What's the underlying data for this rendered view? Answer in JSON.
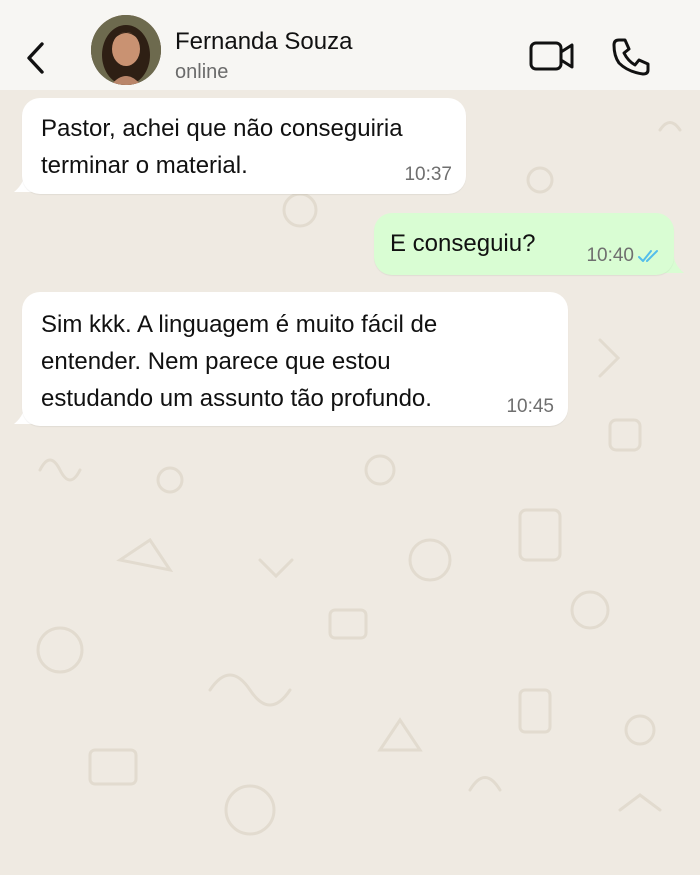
{
  "header": {
    "contact_name": "Fernanda Souza",
    "status": "online",
    "icons": {
      "back": "chevron-left-icon",
      "video": "video-camera-icon",
      "call": "phone-icon"
    }
  },
  "messages": [
    {
      "direction": "incoming",
      "text_lines": [
        "Pastor, achei que não conseguiria",
        "terminar o material."
      ],
      "time": "10:37"
    },
    {
      "direction": "outgoing",
      "text_lines": [
        "E conseguiu?"
      ],
      "time": "10:40",
      "status": "read"
    },
    {
      "direction": "incoming",
      "text_lines": [
        "Sim kkk. A linguagem é muito fácil de",
        "entender. Nem parece que estou",
        "estudando um assunto tão profundo."
      ],
      "time": "10:45"
    }
  ],
  "colors": {
    "header_bg": "#f7f6f3",
    "chat_bg": "#efeae2",
    "incoming_bubble": "#ffffff",
    "outgoing_bubble": "#d9fdd3",
    "read_ticks": "#53bdeb"
  }
}
